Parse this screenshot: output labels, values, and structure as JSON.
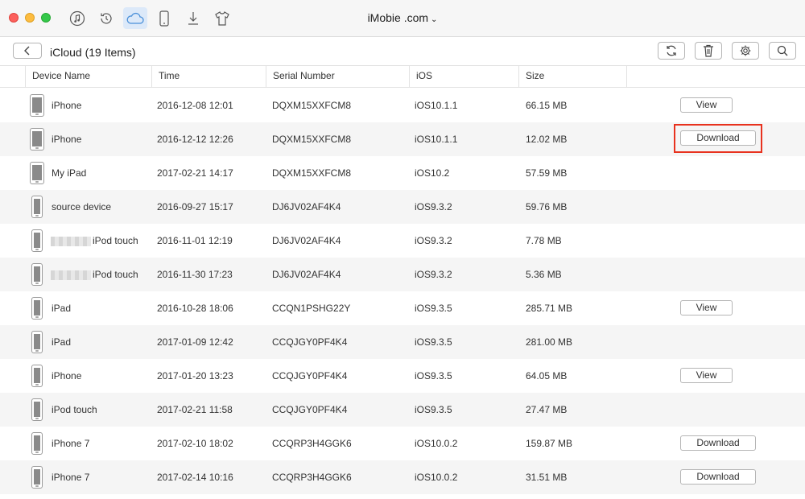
{
  "account": {
    "name": "iMobie .com",
    "chevron": "⌄"
  },
  "titlebar_icons": [
    "itunes-icon",
    "restore-icon",
    "icloud-icon",
    "device-icon",
    "download-icon",
    "shirt-icon"
  ],
  "toolbar": {
    "title": "iCloud (19 Items)"
  },
  "table": {
    "headers": [
      "Device Name",
      "Time",
      "Serial Number",
      "iOS",
      "Size"
    ],
    "rows": [
      {
        "name": "iPhone",
        "time": "2016-12-08 12:01",
        "serial": "DQXM15XXFCM8",
        "ios": "iOS10.1.1",
        "size": "66.15 MB",
        "action": "View"
      },
      {
        "name": "iPhone",
        "time": "2016-12-12 12:26",
        "serial": "DQXM15XXFCM8",
        "ios": "iOS10.1.1",
        "size": "12.02 MB",
        "action": "Download"
      },
      {
        "name": "My iPad",
        "time": "2017-02-21 14:17",
        "serial": "DQXM15XXFCM8",
        "ios": "iOS10.2",
        "size": "57.59 MB",
        "action": ""
      },
      {
        "name": "source device",
        "time": "2016-09-27 15:17",
        "serial": "DJ6JV02AF4K4",
        "ios": "iOS9.3.2",
        "size": "59.76 MB",
        "action": ""
      },
      {
        "name": "iPod touch",
        "time": "2016-11-01 12:19",
        "serial": "DJ6JV02AF4K4",
        "ios": "iOS9.3.2",
        "size": "7.78 MB",
        "action": ""
      },
      {
        "name": "iPod touch",
        "time": "2016-11-30 17:23",
        "serial": "DJ6JV02AF4K4",
        "ios": "iOS9.3.2",
        "size": "5.36 MB",
        "action": ""
      },
      {
        "name": "iPad",
        "time": "2016-10-28 18:06",
        "serial": "CCQN1PSHG22Y",
        "ios": "iOS9.3.5",
        "size": "285.71 MB",
        "action": "View"
      },
      {
        "name": "iPad",
        "time": "2017-01-09 12:42",
        "serial": "CCQJGY0PF4K4",
        "ios": "iOS9.3.5",
        "size": "281.00 MB",
        "action": ""
      },
      {
        "name": "iPhone",
        "time": "2017-01-20 13:23",
        "serial": "CCQJGY0PF4K4",
        "ios": "iOS9.3.5",
        "size": "64.05 MB",
        "action": "View"
      },
      {
        "name": "iPod touch",
        "time": "2017-02-21 11:58",
        "serial": "CCQJGY0PF4K4",
        "ios": "iOS9.3.5",
        "size": "27.47 MB",
        "action": ""
      },
      {
        "name": "iPhone 7",
        "time": "2017-02-10 18:02",
        "serial": "CCQRP3H4GGK6",
        "ios": "iOS10.0.2",
        "size": "159.87 MB",
        "action": "Download"
      },
      {
        "name": "iPhone 7",
        "time": "2017-02-14 10:16",
        "serial": "CCQRP3H4GGK6",
        "ios": "iOS10.0.2",
        "size": "31.51 MB",
        "action": "Download"
      }
    ]
  },
  "colors": {
    "highlight": "#e8321e",
    "active_tab": "#dce9f9",
    "icloud_accent": "#4a90d9"
  }
}
